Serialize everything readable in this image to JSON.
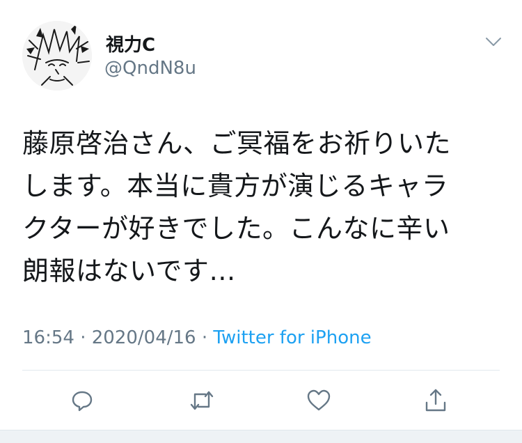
{
  "tweet": {
    "display_name": "視力C",
    "handle": "@QndN8u",
    "text_lines": [
      "藤原啓治さん、ご冥福をお祈りいた",
      "します。本当に貴方が演じるキャラ",
      "クターが好きでした。こんなに辛い",
      "朗報はないです…"
    ],
    "time": "16:54",
    "separator_1": " · ",
    "date": "2020/04/16",
    "separator_2": " · ",
    "source": "Twitter for iPhone"
  },
  "icons": {
    "more": "chevron-down-icon",
    "reply": "reply-icon",
    "retweet": "retweet-icon",
    "like": "heart-icon",
    "share": "share-icon"
  },
  "colors": {
    "text": "#14171a",
    "secondary": "#657786",
    "link": "#1da1f2",
    "divider": "#e1e8ed"
  }
}
